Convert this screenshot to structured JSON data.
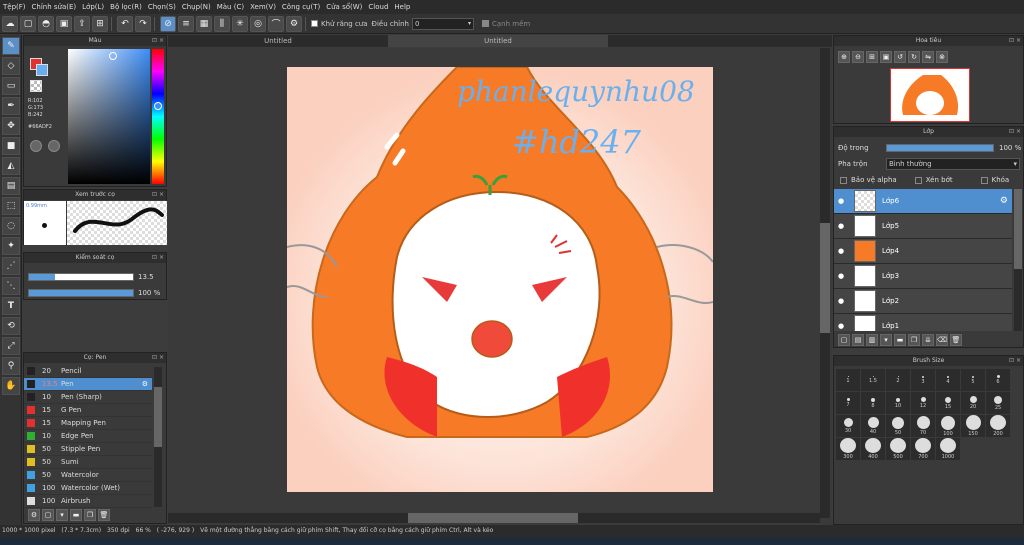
{
  "menu": [
    "Tệp(F)",
    "Chỉnh sửa(E)",
    "Lớp(L)",
    "Bộ lọc(R)",
    "Chọn(S)",
    "Chụp(N)",
    "Màu (C)",
    "Xem(V)",
    "Công cụ(T)",
    "Cửa sổ(W)",
    "Cloud",
    "Help"
  ],
  "toolbar": {
    "antialias_label": "Khử răng cưa",
    "correction_label": "Điều chỉnh",
    "correction_value": "0",
    "smooth_label": "Cạnh mềm"
  },
  "tabs": [
    "Untitled",
    "Untitled"
  ],
  "color_panel": {
    "title": "Màu",
    "r": "R:102",
    "g": "G:173",
    "b": "B:242",
    "hex": "#66ADF2"
  },
  "preview_panel": {
    "title": "Xem trước cọ",
    "size": "0.99mm"
  },
  "brush_control": {
    "title": "Kiểm soát cọ",
    "size": "13.5",
    "opacity": "100 %"
  },
  "brush_list": {
    "title": "Cọ: Pen",
    "items": [
      {
        "num": "20",
        "name": "Pencil",
        "color": "#222222"
      },
      {
        "num": "13.5",
        "name": "Pen",
        "color": "#4f8fd0"
      },
      {
        "num": "10",
        "name": "Pen (Sharp)",
        "color": "#222222"
      },
      {
        "num": "15",
        "name": "G Pen",
        "color": "#e03030"
      },
      {
        "num": "15",
        "name": "Mapping Pen",
        "color": "#e03030"
      },
      {
        "num": "10",
        "name": "Edge Pen",
        "color": "#30b030"
      },
      {
        "num": "50",
        "name": "Stipple Pen",
        "color": "#e0c020"
      },
      {
        "num": "50",
        "name": "Sumi",
        "color": "#e0c020"
      },
      {
        "num": "50",
        "name": "Watercolor",
        "color": "#40a0e0"
      },
      {
        "num": "100",
        "name": "Watercolor (Wet)",
        "color": "#40a0e0"
      },
      {
        "num": "100",
        "name": "Airbrush",
        "color": "#dddddd"
      }
    ]
  },
  "navigator": {
    "title": "Hoa tiêu"
  },
  "layers": {
    "title": "Lớp",
    "opacity_label": "Độ trong",
    "opacity_value": "100 %",
    "blend_label": "Pha trộn",
    "blend_value": "Bình thường",
    "protect_alpha": "Bảo vệ alpha",
    "clipping": "Xén bớt",
    "lock": "Khóa",
    "items": [
      "Lớp6",
      "Lớp5",
      "Lớp4",
      "Lớp3",
      "Lớp2",
      "Lớp1"
    ]
  },
  "brush_size": {
    "title": "Brush Size",
    "sizes": [
      "1",
      "1.5",
      "2",
      "3",
      "4",
      "5",
      "6",
      "7",
      "8",
      "10",
      "12",
      "15",
      "20",
      "25",
      "30",
      "40",
      "50",
      "70",
      "100",
      "150",
      "200",
      "300",
      "400",
      "500",
      "700",
      "1000"
    ]
  },
  "canvas_text": {
    "line1": "phanlequynhu08",
    "line2": "#hd247"
  },
  "status": {
    "size": "1000 * 1000 pixel",
    "cm": "(7.3 * 7.3cm)",
    "dpi": "350 dpi",
    "zoom": "66 %",
    "coord": "( -276, 929 )",
    "hint": "Vẽ một đường thẳng bằng cách giữ phím Shift, Thay đổi cỡ cọ bằng cách giữ phím Ctrl, Alt và kéo"
  }
}
